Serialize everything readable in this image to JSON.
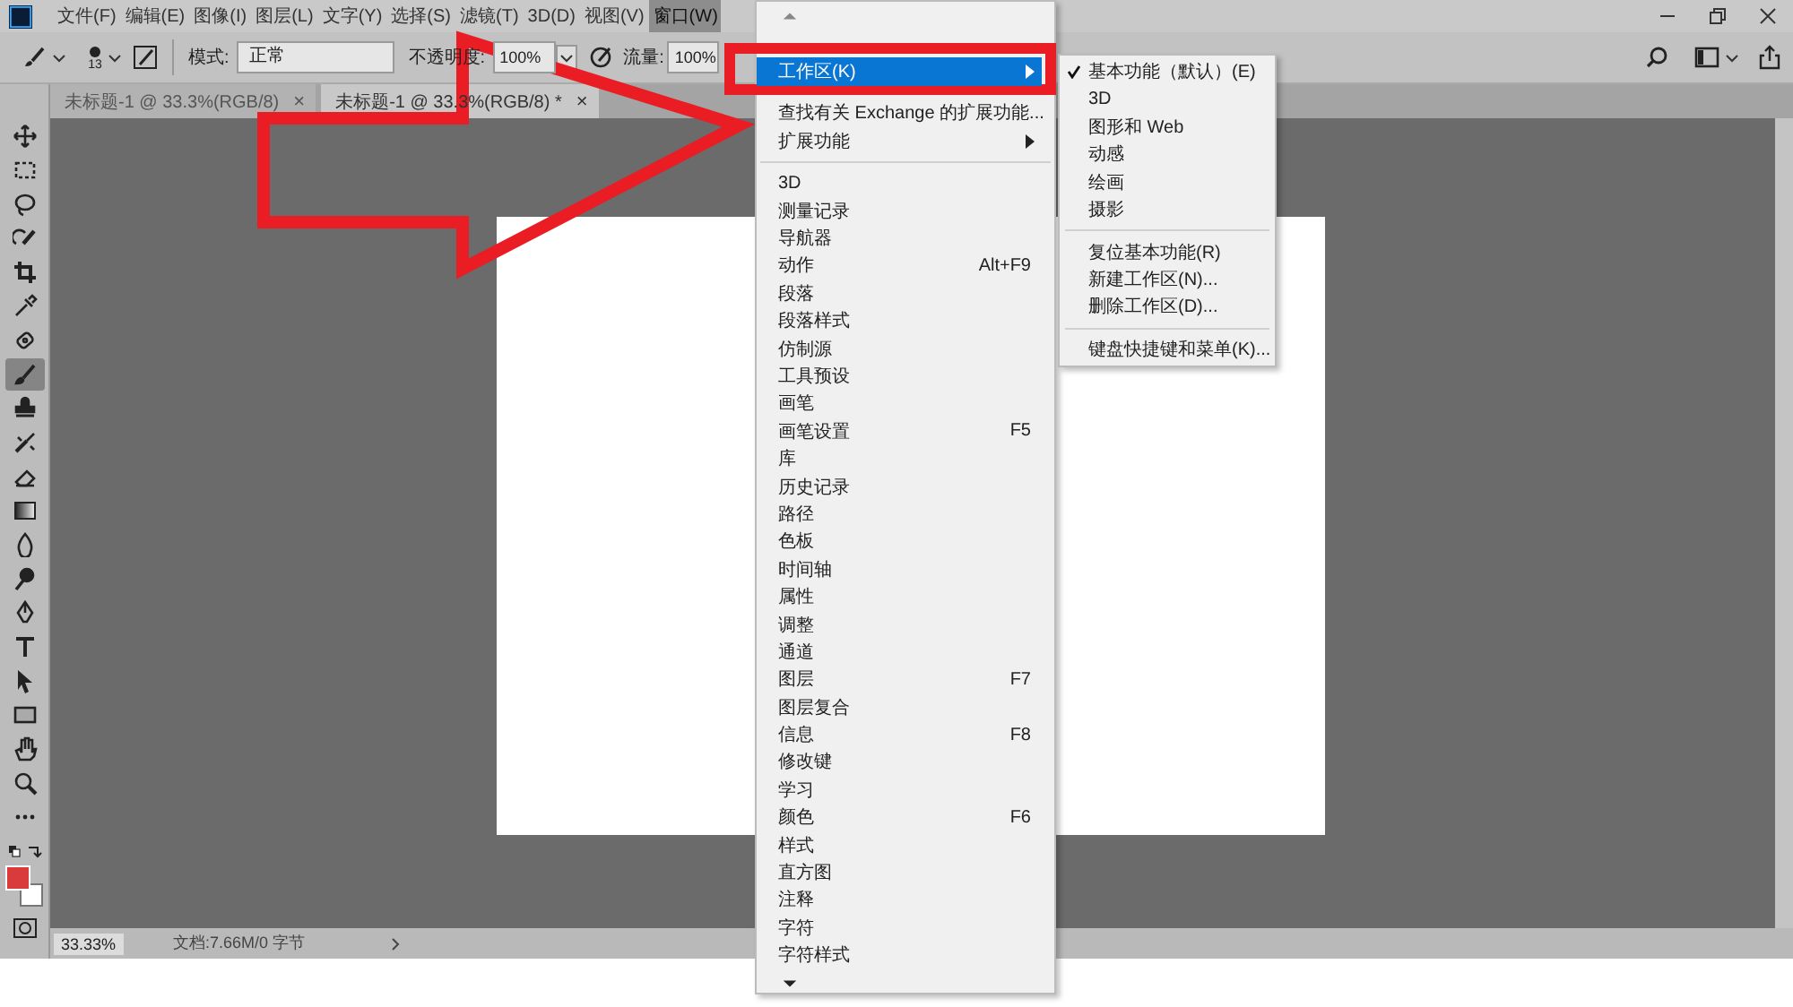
{
  "menu_bar": {
    "items": [
      {
        "label": "文件(F)",
        "selected": false
      },
      {
        "label": "编辑(E)",
        "selected": false
      },
      {
        "label": "图像(I)",
        "selected": false
      },
      {
        "label": "图层(L)",
        "selected": false
      },
      {
        "label": "文字(Y)",
        "selected": false
      },
      {
        "label": "选择(S)",
        "selected": false
      },
      {
        "label": "滤镜(T)",
        "selected": false
      },
      {
        "label": "3D(D)",
        "selected": false
      },
      {
        "label": "视图(V)",
        "selected": false
      },
      {
        "label": "窗口(W)",
        "selected": true
      }
    ]
  },
  "options_bar": {
    "brush_size": "13",
    "mode_label": "模式:",
    "mode_value": "正常",
    "opacity_label": "不透明度:",
    "opacity_value": "100%",
    "flow_label": "流量:",
    "flow_value": "100%"
  },
  "tabs": [
    {
      "label": "未标题-1 @ 33.3%(RGB/8)",
      "close": "×",
      "selected": false
    },
    {
      "label": "未标题-1 @ 33.3%(RGB/8) *",
      "close": "×",
      "selected": true
    }
  ],
  "tools": [
    {
      "selected": false
    },
    {
      "selected": false
    },
    {
      "selected": false
    },
    {
      "selected": false
    },
    {
      "selected": false
    },
    {
      "selected": false
    },
    {
      "selected": false
    },
    {
      "selected": true
    },
    {
      "selected": false
    },
    {
      "selected": false
    },
    {
      "selected": false
    },
    {
      "selected": false
    },
    {
      "selected": false
    },
    {
      "selected": false
    },
    {
      "selected": false
    },
    {
      "selected": false
    },
    {
      "selected": false
    },
    {
      "selected": false
    },
    {
      "selected": false
    },
    {
      "selected": false
    },
    {
      "selected": false
    }
  ],
  "status_bar": {
    "zoom": "33.33%",
    "document": "文档:7.66M/0 字节"
  },
  "window_menu": {
    "items": [
      {
        "kind": "item",
        "label": "工作区(K)",
        "submenu": true,
        "selected": true
      },
      {
        "kind": "separator"
      },
      {
        "kind": "item",
        "label": "查找有关 Exchange 的扩展功能...",
        "selected": false
      },
      {
        "kind": "item",
        "label": "扩展功能",
        "submenu": true,
        "selected": false
      },
      {
        "kind": "separator"
      },
      {
        "kind": "item",
        "label": "3D",
        "selected": false
      },
      {
        "kind": "item",
        "label": "测量记录",
        "selected": false
      },
      {
        "kind": "item",
        "label": "导航器",
        "selected": false
      },
      {
        "kind": "item",
        "label": "动作",
        "shortcut": "Alt+F9",
        "selected": false
      },
      {
        "kind": "item",
        "label": "段落",
        "selected": false
      },
      {
        "kind": "item",
        "label": "段落样式",
        "selected": false
      },
      {
        "kind": "item",
        "label": "仿制源",
        "selected": false
      },
      {
        "kind": "item",
        "label": "工具预设",
        "selected": false
      },
      {
        "kind": "item",
        "label": "画笔",
        "selected": false
      },
      {
        "kind": "item",
        "label": "画笔设置",
        "shortcut": "F5",
        "selected": false
      },
      {
        "kind": "item",
        "label": "库",
        "selected": false
      },
      {
        "kind": "item",
        "label": "历史记录",
        "selected": false
      },
      {
        "kind": "item",
        "label": "路径",
        "selected": false
      },
      {
        "kind": "item",
        "label": "色板",
        "selected": false
      },
      {
        "kind": "item",
        "label": "时间轴",
        "selected": false
      },
      {
        "kind": "item",
        "label": "属性",
        "selected": false
      },
      {
        "kind": "item",
        "label": "调整",
        "selected": false
      },
      {
        "kind": "item",
        "label": "通道",
        "selected": false
      },
      {
        "kind": "item",
        "label": "图层",
        "shortcut": "F7",
        "selected": false
      },
      {
        "kind": "item",
        "label": "图层复合",
        "selected": false
      },
      {
        "kind": "item",
        "label": "信息",
        "shortcut": "F8",
        "selected": false
      },
      {
        "kind": "item",
        "label": "修改键",
        "selected": false
      },
      {
        "kind": "item",
        "label": "学习",
        "selected": false
      },
      {
        "kind": "item",
        "label": "颜色",
        "shortcut": "F6",
        "selected": false
      },
      {
        "kind": "item",
        "label": "样式",
        "selected": false
      },
      {
        "kind": "item",
        "label": "直方图",
        "selected": false
      },
      {
        "kind": "item",
        "label": "注释",
        "selected": false
      },
      {
        "kind": "item",
        "label": "字符",
        "selected": false
      },
      {
        "kind": "item",
        "label": "字符样式",
        "selected": false
      }
    ]
  },
  "workspace_submenu": {
    "items": [
      {
        "kind": "item",
        "label": "基本功能（默认）(E)",
        "checked": true
      },
      {
        "kind": "item",
        "label": "3D",
        "checked": false
      },
      {
        "kind": "item",
        "label": "图形和 Web",
        "checked": false
      },
      {
        "kind": "item",
        "label": "动感",
        "checked": false
      },
      {
        "kind": "item",
        "label": "绘画",
        "checked": false
      },
      {
        "kind": "item",
        "label": "摄影",
        "checked": false
      },
      {
        "kind": "separator"
      },
      {
        "kind": "item",
        "label": "复位基本功能(R)",
        "checked": false
      },
      {
        "kind": "item",
        "label": "新建工作区(N)...",
        "checked": false
      },
      {
        "kind": "item",
        "label": "删除工作区(D)...",
        "checked": false
      },
      {
        "kind": "separator"
      },
      {
        "kind": "item",
        "label": "键盘快捷键和菜单(K)...",
        "checked": false
      }
    ]
  }
}
